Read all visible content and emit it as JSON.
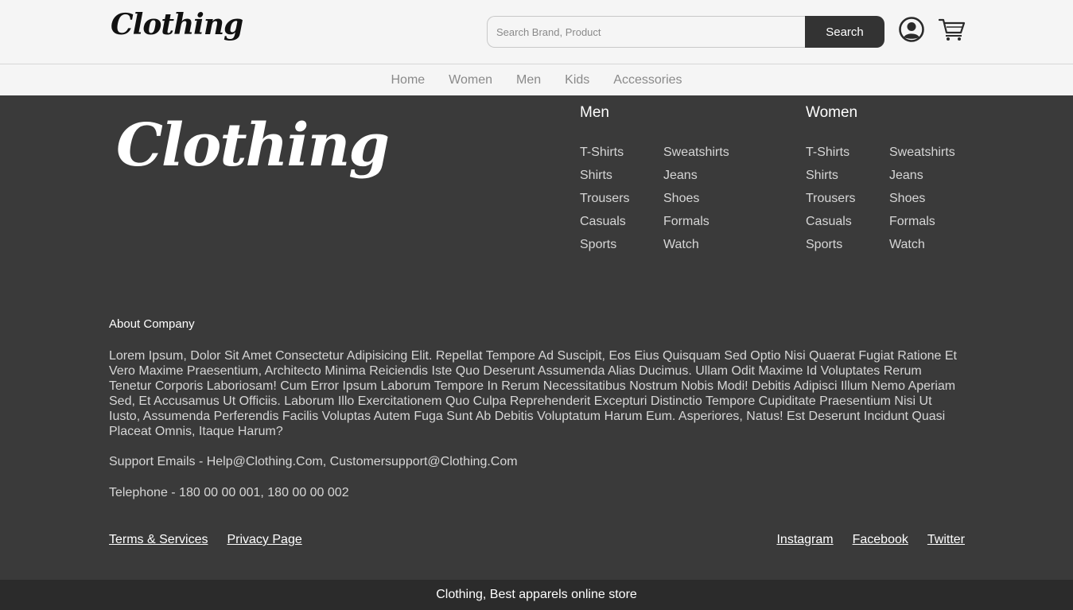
{
  "header": {
    "logo": "Clothing",
    "search_placeholder": "Search Brand, Product",
    "search_button": "Search",
    "icons": {
      "account": "user-icon",
      "cart": "cart-icon"
    }
  },
  "nav": {
    "items": [
      "Home",
      "Women",
      "Men",
      "Kids",
      "Accessories"
    ]
  },
  "footer": {
    "logo": "Clothing",
    "men": {
      "title": "Men",
      "col1": [
        "T-Shirts",
        "Shirts",
        "Trousers",
        "Casuals",
        "Sports"
      ],
      "col2": [
        "Sweatshirts",
        "Jeans",
        "Shoes",
        "Formals",
        "Watch"
      ]
    },
    "women": {
      "title": "Women",
      "col1": [
        "T-Shirts",
        "Shirts",
        "Trousers",
        "Casuals",
        "Sports"
      ],
      "col2": [
        "Sweatshirts",
        "Jeans",
        "Shoes",
        "Formals",
        "Watch"
      ]
    },
    "about_title": "About Company",
    "about_text": "Lorem Ipsum, Dolor Sit Amet Consectetur Adipisicing Elit. Repellat Tempore Ad Suscipit, Eos Eius Quisquam Sed Optio Nisi Quaerat Fugiat Ratione Et Vero Maxime Praesentium, Architecto Minima Reiciendis Iste Quo Deserunt Assumenda Alias Ducimus. Ullam Odit Maxime Id Voluptates Rerum Tenetur Corporis Laboriosam! Cum Error Ipsum Laborum Tempore In Rerum Necessitatibus Nostrum Nobis Modi! Debitis Adipisci Illum Nemo Aperiam Sed, Et Accusamus Ut Officiis. Laborum Illo Exercitationem Quo Culpa Reprehenderit Excepturi Distinctio Tempore Cupiditate Praesentium Nisi Ut Iusto, Assumenda Perferendis Facilis Voluptas Autem Fuga Sunt Ab Debitis Voluptatum Harum Eum. Asperiores, Natus! Est Deserunt Incidunt Quasi Placeat Omnis, Itaque Harum?",
    "support": "Support Emails - Help@Clothing.Com, Customersupport@Clothing.Com",
    "telephone": "Telephone - 180 00 00 001, 180 00 00 002",
    "legal": [
      "Terms & Services",
      "Privacy Page"
    ],
    "social": [
      "Instagram",
      "Facebook",
      "Twitter"
    ],
    "bottom": "Clothing, Best apparels online store"
  },
  "colors": {
    "header_bg": "#f5f5f5",
    "footer_bg": "#3a3a3a",
    "bottom_bar_bg": "#2b2b2b",
    "search_button_bg": "#333333",
    "nav_text": "#8a8a8a"
  }
}
